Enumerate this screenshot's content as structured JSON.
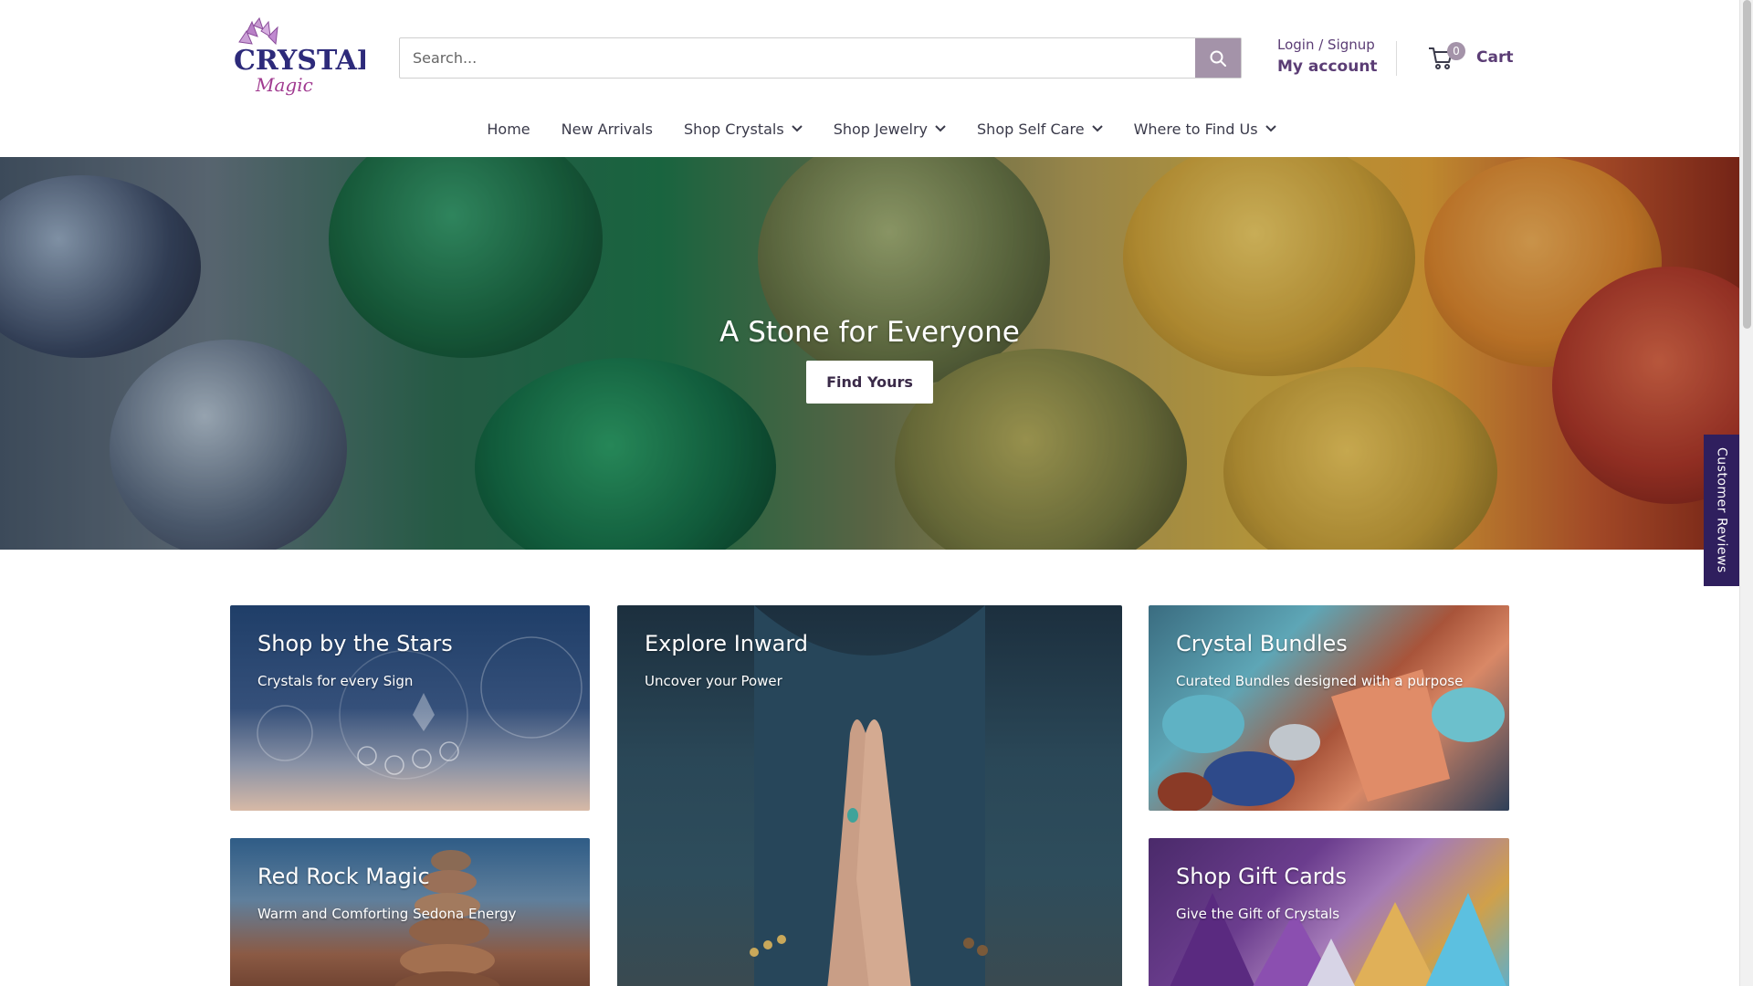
{
  "brand": {
    "logo_text": "CRYSTAL",
    "logo_script": "Magic",
    "accent": "#5b3d75",
    "button_bg": "#a493a9"
  },
  "search": {
    "placeholder": "Search...",
    "value": ""
  },
  "account": {
    "login_label": "Login / Signup",
    "my_account_label": "My account"
  },
  "cart": {
    "count": "0",
    "label": "Cart"
  },
  "nav": {
    "items": [
      {
        "label": "Home",
        "has_dropdown": false
      },
      {
        "label": "New Arrivals",
        "has_dropdown": false
      },
      {
        "label": "Shop Crystals",
        "has_dropdown": true
      },
      {
        "label": "Shop Jewelry",
        "has_dropdown": true
      },
      {
        "label": "Shop Self Care",
        "has_dropdown": true
      },
      {
        "label": "Where to Find Us",
        "has_dropdown": true
      }
    ]
  },
  "hero": {
    "title": "A Stone for Everyone",
    "button_label": "Find Yours"
  },
  "reviews_tab": {
    "label": "Customer Reviews"
  },
  "collections": [
    {
      "title": "Shop by the Stars",
      "subtitle": "Crystals for every Sign"
    },
    {
      "title": "Explore Inward",
      "subtitle": "Uncover your Power"
    },
    {
      "title": "Crystal Bundles",
      "subtitle": "Curated Bundles designed with a purpose"
    },
    {
      "title": "Red Rock Magic",
      "subtitle": "Warm and Comforting Sedona Energy"
    },
    {
      "title": "Shop Gift Cards",
      "subtitle": "Give the Gift of Crystals"
    }
  ]
}
